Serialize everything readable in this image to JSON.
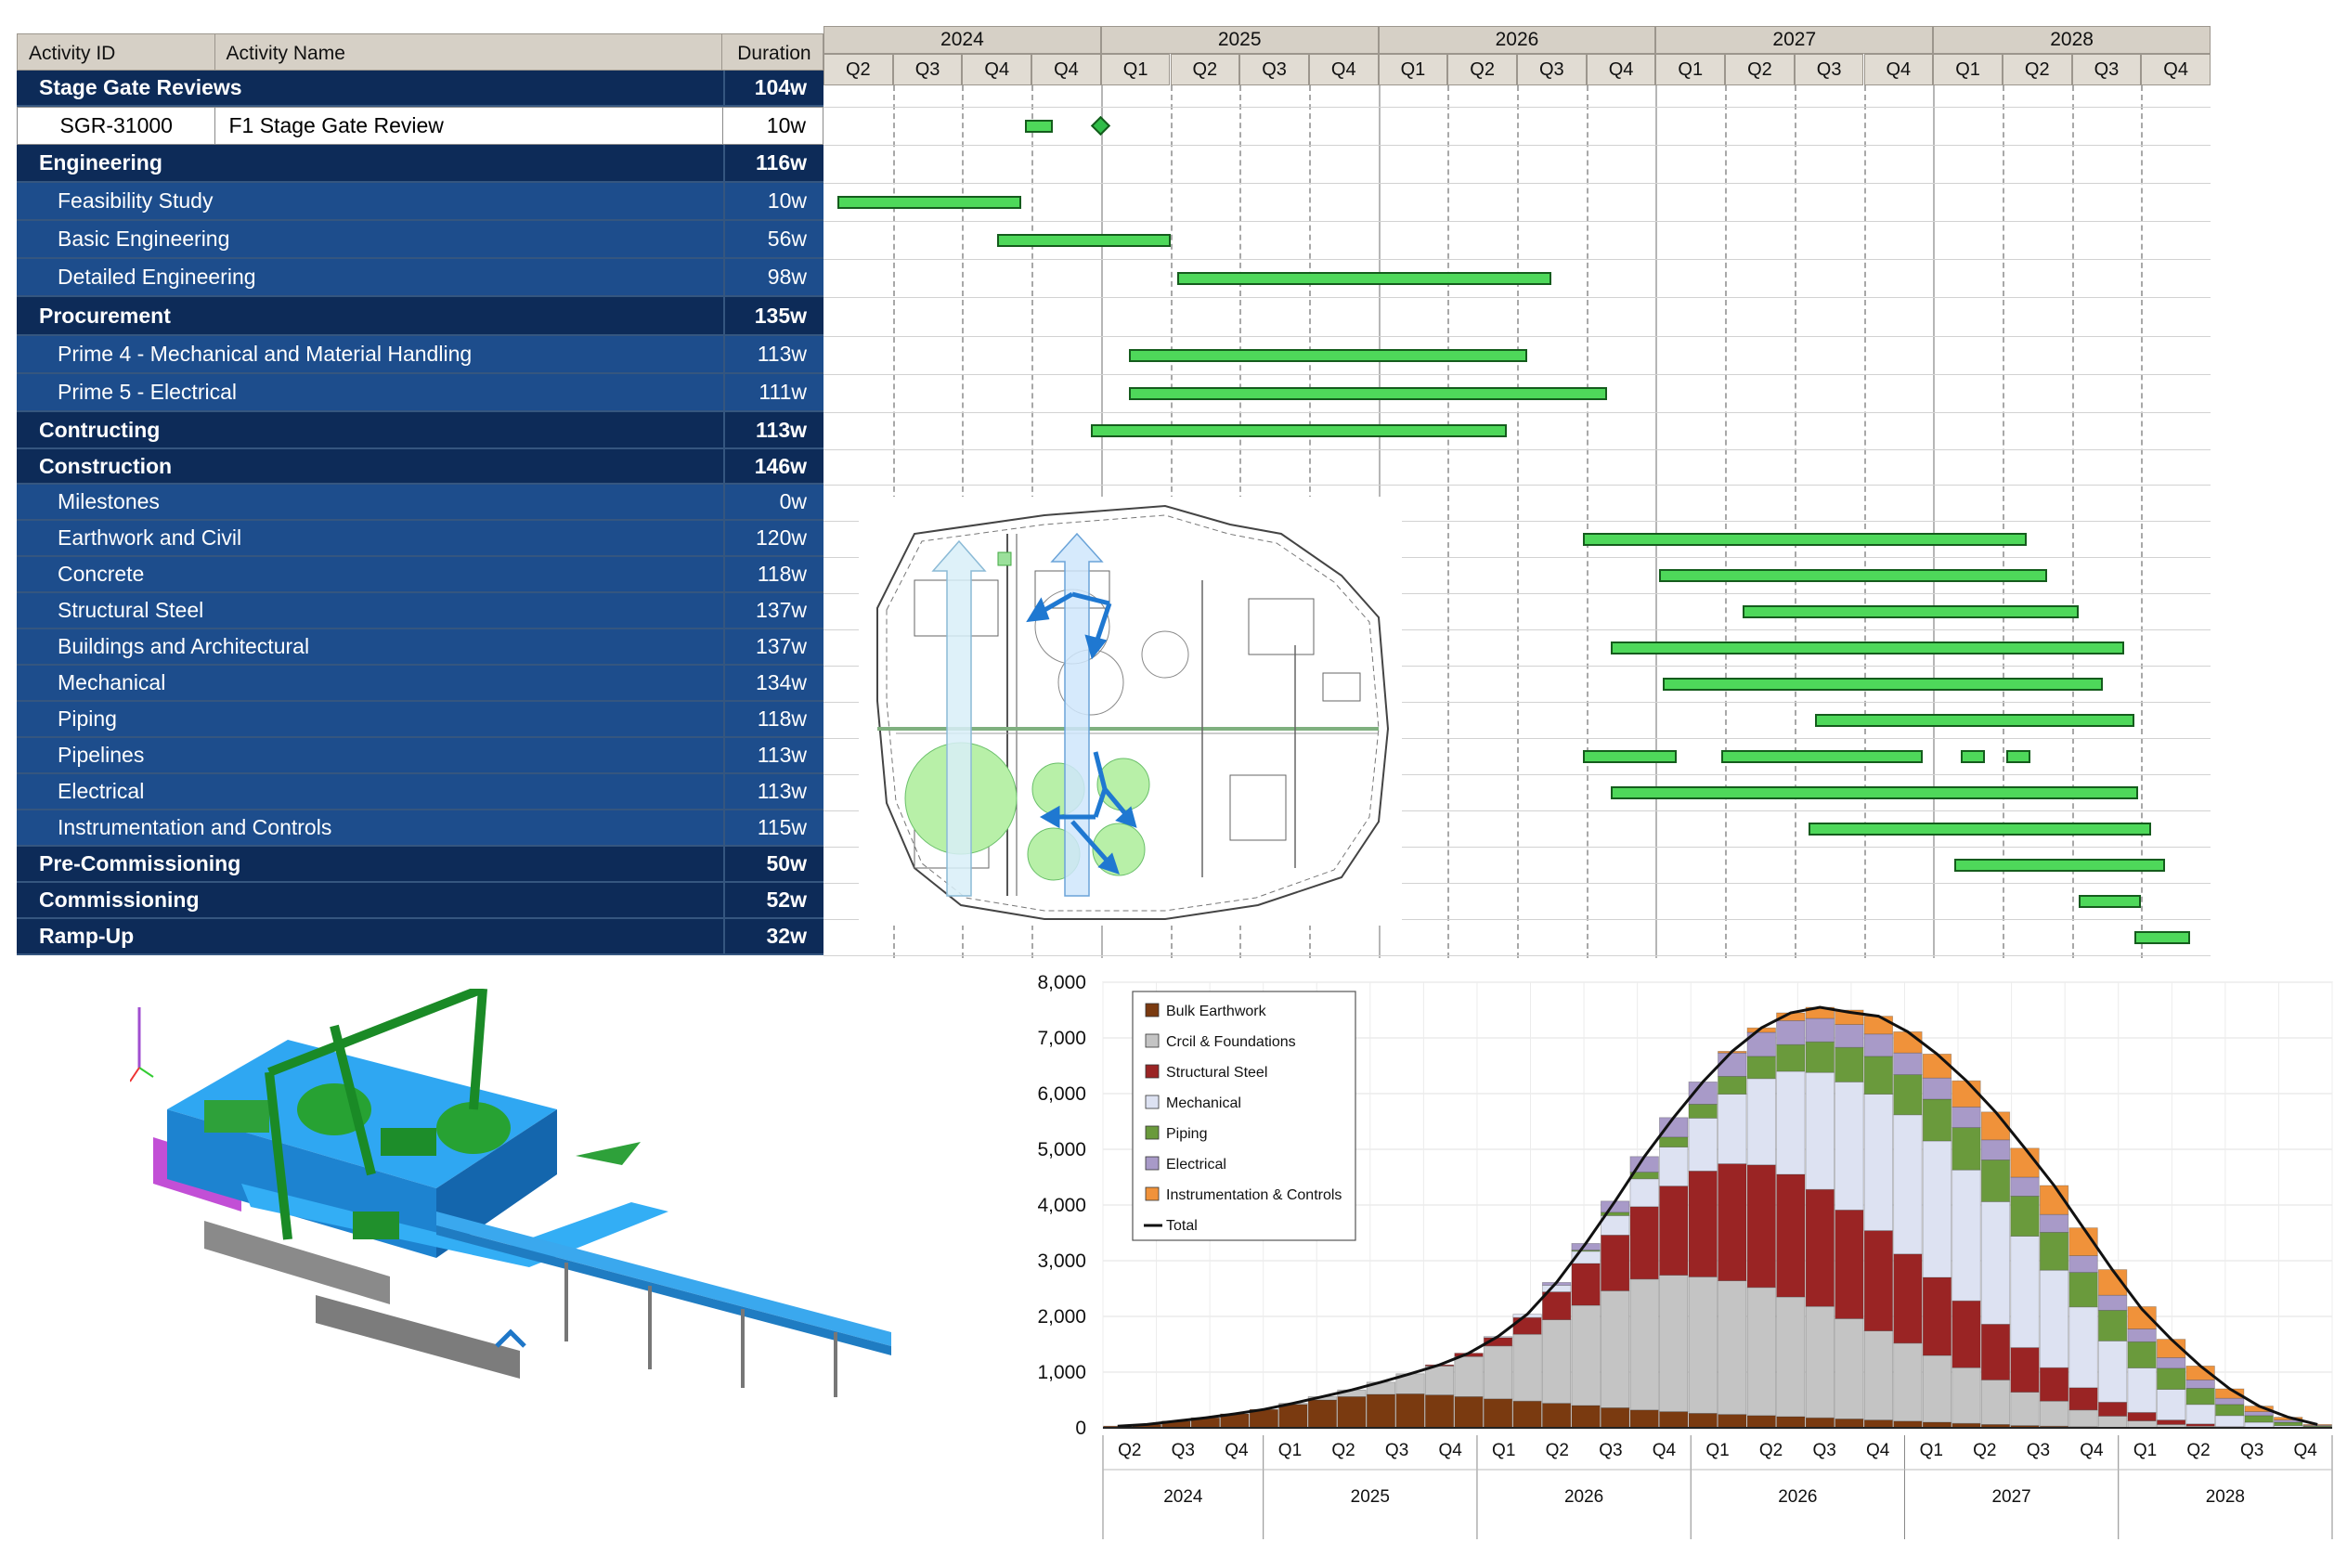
{
  "table": {
    "headers": {
      "id": "Activity ID",
      "name": "Activity Name",
      "duration": "Duration"
    },
    "rows": [
      {
        "type": "group",
        "name": "Stage Gate Reviews",
        "duration": "104w"
      },
      {
        "type": "white",
        "id": "SGR-31000",
        "name": "F1 Stage Gate Review",
        "duration": "10w"
      },
      {
        "type": "group",
        "name": "Engineering",
        "duration": "116w"
      },
      {
        "type": "child",
        "name": "Feasibility Study",
        "duration": "10w"
      },
      {
        "type": "child",
        "name": "Basic Engineering",
        "duration": "56w"
      },
      {
        "type": "child",
        "name": "Detailed Engineering",
        "duration": "98w"
      },
      {
        "type": "group",
        "name": "Procurement",
        "duration": "135w"
      },
      {
        "type": "child",
        "name": "Prime 4 - Mechanical  and Material Handling",
        "duration": "113w"
      },
      {
        "type": "child",
        "name": "Prime 5 - Electrical",
        "duration": "111w"
      },
      {
        "type": "group",
        "name": "Contructing",
        "duration": "113w"
      },
      {
        "type": "group",
        "name": "Construction",
        "duration": "146w"
      },
      {
        "type": "child",
        "name": "Milestones",
        "duration": "0w"
      },
      {
        "type": "child",
        "name": "Earthwork and Civil",
        "duration": "120w"
      },
      {
        "type": "child",
        "name": "Concrete",
        "duration": "118w"
      },
      {
        "type": "child",
        "name": "Structural Steel",
        "duration": "137w"
      },
      {
        "type": "child",
        "name": "Buildings and Architectural",
        "duration": "137w"
      },
      {
        "type": "child",
        "name": "Mechanical",
        "duration": "134w"
      },
      {
        "type": "child",
        "name": "Piping",
        "duration": "118w"
      },
      {
        "type": "child",
        "name": "Pipelines",
        "duration": "113w"
      },
      {
        "type": "child",
        "name": "Electrical",
        "duration": "113w"
      },
      {
        "type": "child",
        "name": "Instrumentation and Controls",
        "duration": "115w"
      },
      {
        "type": "group",
        "name": "Pre-Commissioning",
        "duration": "50w"
      },
      {
        "type": "group",
        "name": "Commissioning",
        "duration": "52w"
      },
      {
        "type": "group",
        "name": "Ramp-Up",
        "duration": "32w"
      }
    ]
  },
  "gantt": {
    "years": [
      "2024",
      "2025",
      "2026",
      "2027",
      "2028"
    ],
    "quarters": [
      "Q2",
      "Q3",
      "Q4",
      "Q4",
      "Q1",
      "Q2",
      "Q3",
      "Q4",
      "Q1",
      "Q2",
      "Q3",
      "Q4",
      "Q1",
      "Q2",
      "Q3",
      "Q4",
      "Q1",
      "Q2",
      "Q3",
      "Q4"
    ],
    "bars": [
      {
        "row": 1,
        "start": 2.9,
        "end": 3.3
      },
      {
        "row": 3,
        "start": 0.2,
        "end": 2.85
      },
      {
        "row": 4,
        "start": 2.5,
        "end": 5.0
      },
      {
        "row": 5,
        "start": 5.1,
        "end": 10.5
      },
      {
        "row": 7,
        "start": 4.4,
        "end": 10.15
      },
      {
        "row": 8,
        "start": 4.4,
        "end": 11.3
      },
      {
        "row": 9,
        "start": 3.85,
        "end": 9.85
      },
      {
        "row": 12,
        "start": 10.95,
        "end": 17.35
      },
      {
        "row": 13,
        "start": 12.05,
        "end": 17.65
      },
      {
        "row": 14,
        "start": 13.25,
        "end": 18.1
      },
      {
        "row": 15,
        "start": 11.35,
        "end": 18.75
      },
      {
        "row": 16,
        "start": 12.1,
        "end": 18.45
      },
      {
        "row": 17,
        "start": 14.3,
        "end": 18.9
      },
      {
        "row": 18,
        "start": 10.95,
        "end": 12.3
      },
      {
        "row": 18,
        "start": 12.95,
        "end": 15.85
      },
      {
        "row": 18,
        "start": 16.4,
        "end": 16.75
      },
      {
        "row": 18,
        "start": 17.05,
        "end": 17.4
      },
      {
        "row": 19,
        "start": 11.35,
        "end": 18.95
      },
      {
        "row": 20,
        "start": 14.2,
        "end": 19.15
      },
      {
        "row": 21,
        "start": 16.3,
        "end": 19.35
      },
      {
        "row": 22,
        "start": 18.1,
        "end": 19.0
      },
      {
        "row": 23,
        "start": 18.9,
        "end": 19.7
      }
    ],
    "milestones": [
      {
        "row": 1,
        "at": 4.0
      }
    ]
  },
  "chart_data": {
    "type": "bar",
    "stacked": true,
    "x_tick_quarters": [
      "Q2",
      "Q3",
      "Q4",
      "Q1",
      "Q2",
      "Q3",
      "Q4",
      "Q1",
      "Q2",
      "Q3",
      "Q4",
      "Q1",
      "Q2",
      "Q3",
      "Q4",
      "Q1",
      "Q2",
      "Q3",
      "Q4",
      "Q1",
      "Q2",
      "Q3",
      "Q4"
    ],
    "x_tick_years": [
      "2024",
      "2025",
      "2026",
      "2026",
      "2027",
      "2028"
    ],
    "ylim": [
      0,
      8000
    ],
    "yticks": [
      "0",
      "1,000",
      "2,000",
      "3,000",
      "4,000",
      "5,000",
      "6,000",
      "7,000",
      "8,000"
    ],
    "legend_position": "top-left",
    "series": [
      {
        "name": "Bulk Earthwork",
        "color": "#7a3a10",
        "values": [
          30,
          60,
          120,
          180,
          250,
          330,
          420,
          500,
          560,
          600,
          610,
          590,
          560,
          520,
          480,
          440,
          400,
          360,
          320,
          290,
          260,
          240,
          220,
          200,
          180,
          160,
          140,
          120,
          100,
          80,
          60,
          40,
          30,
          20,
          10,
          5,
          0,
          0,
          0,
          0,
          0,
          0
        ]
      },
      {
        "name": "Crcil & Foundations",
        "color": "#c4c4c4",
        "values": [
          0,
          0,
          0,
          0,
          0,
          0,
          20,
          60,
          120,
          220,
          360,
          520,
          720,
          950,
          1200,
          1500,
          1800,
          2100,
          2350,
          2450,
          2450,
          2400,
          2300,
          2150,
          2000,
          1800,
          1600,
          1400,
          1200,
          1000,
          800,
          600,
          450,
          300,
          200,
          120,
          60,
          30,
          10,
          0,
          0,
          0
        ]
      },
      {
        "name": "Structural Steel",
        "color": "#9a2424",
        "values": [
          0,
          0,
          0,
          0,
          0,
          0,
          0,
          0,
          0,
          0,
          0,
          20,
          60,
          150,
          300,
          500,
          750,
          1000,
          1300,
          1600,
          1900,
          2100,
          2200,
          2200,
          2100,
          1950,
          1800,
          1600,
          1400,
          1200,
          1000,
          800,
          600,
          400,
          250,
          150,
          80,
          40,
          10,
          0,
          0,
          0
        ]
      },
      {
        "name": "Mechanical",
        "color": "#dde2f2",
        "values": [
          0,
          0,
          0,
          0,
          0,
          0,
          0,
          0,
          0,
          0,
          0,
          0,
          0,
          20,
          60,
          120,
          220,
          350,
          500,
          700,
          950,
          1250,
          1550,
          1850,
          2100,
          2300,
          2450,
          2500,
          2450,
          2350,
          2200,
          2000,
          1750,
          1450,
          1100,
          800,
          550,
          350,
          200,
          100,
          40,
          10
        ]
      },
      {
        "name": "Piping",
        "color": "#6a9a3c",
        "values": [
          0,
          0,
          0,
          0,
          0,
          0,
          0,
          0,
          0,
          0,
          0,
          0,
          0,
          0,
          0,
          0,
          20,
          60,
          120,
          180,
          250,
          320,
          400,
          480,
          550,
          620,
          680,
          720,
          750,
          760,
          750,
          720,
          680,
          620,
          550,
          470,
          380,
          290,
          200,
          120,
          60,
          20
        ]
      },
      {
        "name": "Electrical",
        "color": "#a89ac8",
        "values": [
          0,
          0,
          0,
          0,
          0,
          0,
          0,
          0,
          0,
          0,
          0,
          0,
          0,
          0,
          0,
          50,
          120,
          200,
          280,
          350,
          400,
          420,
          430,
          430,
          420,
          410,
          400,
          390,
          380,
          370,
          360,
          340,
          320,
          300,
          270,
          230,
          190,
          150,
          110,
          70,
          40,
          15
        ]
      },
      {
        "name": "Instrumentation & Controls",
        "color": "#f0923a",
        "values": [
          0,
          0,
          0,
          0,
          0,
          0,
          0,
          0,
          0,
          0,
          0,
          0,
          0,
          0,
          0,
          0,
          0,
          0,
          0,
          0,
          0,
          30,
          80,
          140,
          200,
          260,
          320,
          380,
          430,
          470,
          500,
          520,
          520,
          500,
          460,
          400,
          330,
          250,
          170,
          100,
          50,
          15
        ]
      }
    ],
    "total_label": "Total",
    "total": [
      30,
      60,
      120,
      180,
      250,
      330,
      440,
      560,
      680,
      820,
      970,
      1130,
      1340,
      1640,
      2040,
      2610,
      3310,
      4070,
      4870,
      5570,
      6210,
      6760,
      7180,
      7450,
      7550,
      7460,
      7390,
      7110,
      6710,
      6230,
      5670,
      5020,
      4350,
      3590,
      2830,
      2130,
      1590,
      1110,
      700,
      390,
      190,
      60
    ]
  },
  "images": {
    "siteplan": "site-plan-drawing",
    "model": "3d-plant-model"
  }
}
